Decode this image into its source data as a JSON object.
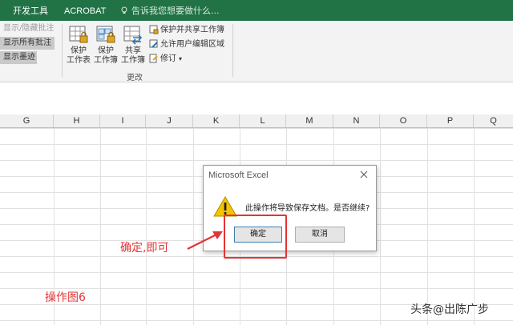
{
  "ribbon_tabs": {
    "developer": "开发工具",
    "acrobat": "ACROBAT"
  },
  "tell_me": {
    "placeholder": "告诉我您想要做什么..."
  },
  "comments": {
    "show_hide": "显示/隐藏批注",
    "show_all": "显示所有批注",
    "show_ink": "显示墨迹"
  },
  "changes_group": {
    "label": "更改",
    "protect_sheet": [
      "保护",
      "工作表"
    ],
    "protect_workbook": [
      "保护",
      "工作簿"
    ],
    "share_workbook": [
      "共享",
      "工作簿"
    ],
    "protect_share": "保护并共享工作簿",
    "allow_edit_ranges": "允许用户编辑区域",
    "track_changes": "修订"
  },
  "columns": [
    "G",
    "H",
    "I",
    "J",
    "K",
    "L",
    "M",
    "N",
    "O",
    "P",
    "Q"
  ],
  "dialog": {
    "title": "Microsoft Excel",
    "message": "此操作将导致保存文档。是否继续?",
    "ok": "确定",
    "cancel": "取消"
  },
  "annotations": {
    "note": "确定,即可",
    "caption": "操作图6",
    "watermark": "头条@出陈广步"
  },
  "colors": {
    "ribbon_green": "#217346",
    "annotation_red": "#e53333",
    "warning_yellow": "#f5c400"
  }
}
